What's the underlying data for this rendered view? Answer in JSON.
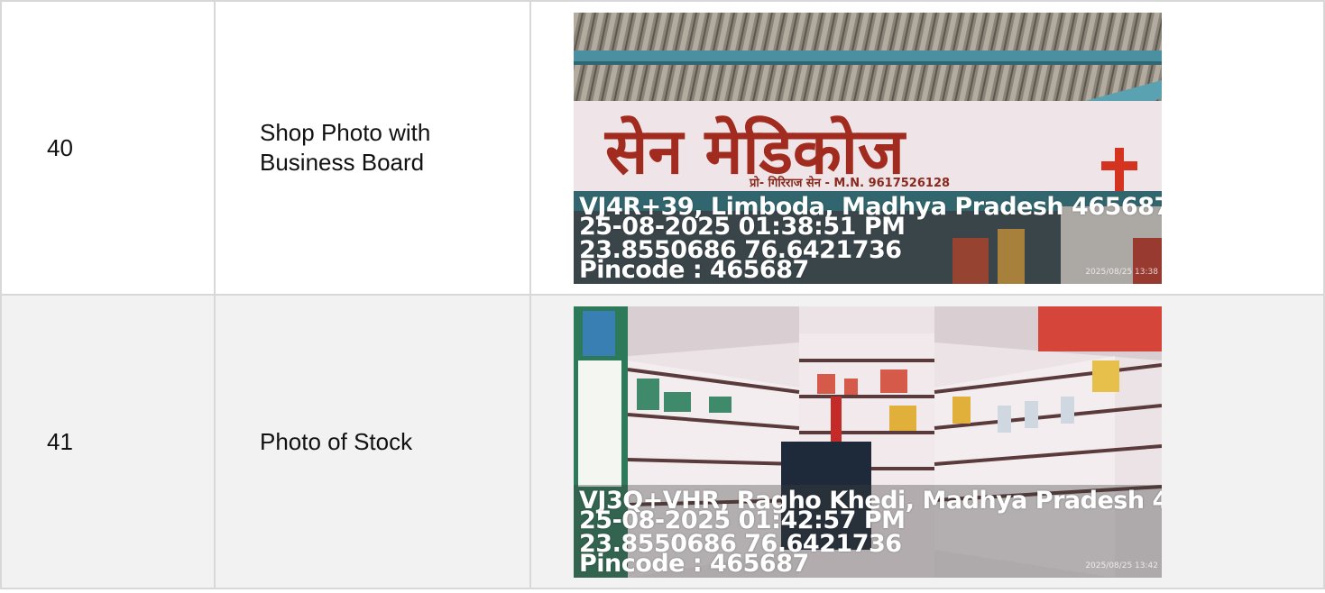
{
  "rows": [
    {
      "number": "40",
      "label_line1": "Shop Photo with",
      "label_line2": "Business Board",
      "photo": {
        "icon": "storefront-photo",
        "sign_text": "सेन मेडिकोज",
        "sign_subtext": "प्रो- गिरिराज सेन - M.N. 9617526128",
        "geo_lines": [
          "VJ4R+39, Limboda, Madhya Pradesh 465687",
          "25-08-2025 01:38:51 PM",
          "23.8550686 76.6421736",
          "Pincode : 465687"
        ],
        "timestamp": "2025/08/25 13:38"
      }
    },
    {
      "number": "41",
      "label_line1": "Photo of Stock",
      "label_line2": "",
      "photo": {
        "icon": "pharmacy-shelves-photo",
        "geo_lines": [
          "VJ3Q+VHR, Ragho Khedi, Madhya Pradesh 4",
          "25-08-2025 01:42:57 PM",
          "23.8550686 76.6421736",
          "Pincode : 465687"
        ],
        "timestamp": "2025/08/25 13:42"
      }
    }
  ]
}
